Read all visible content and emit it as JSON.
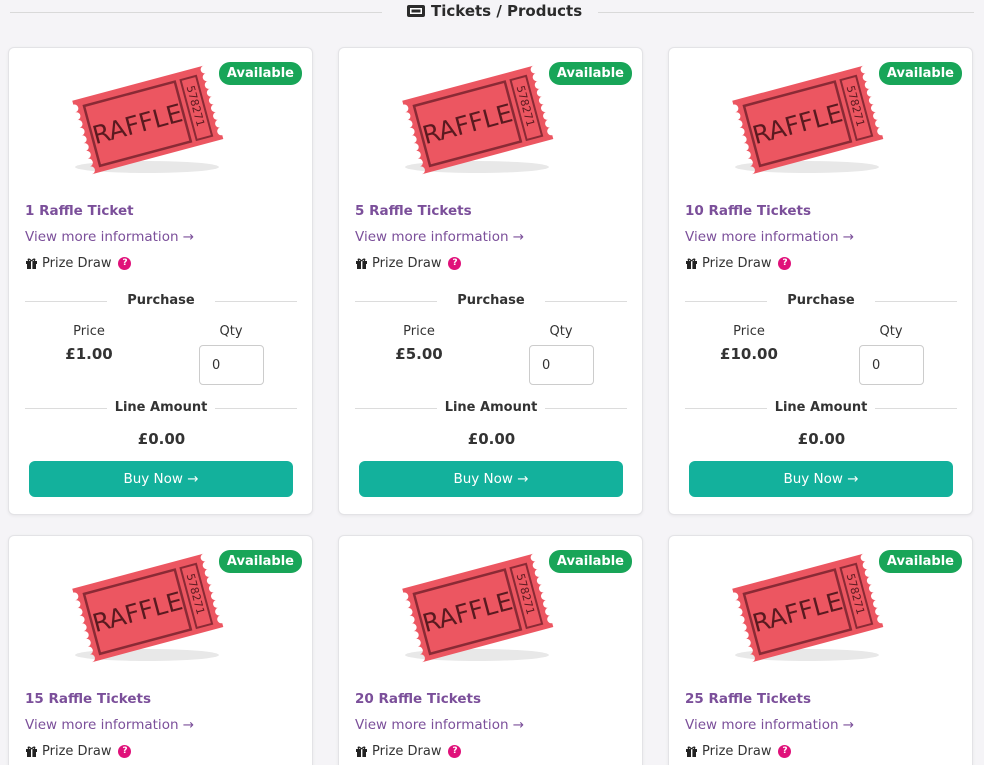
{
  "header": {
    "title": "Tickets / Products",
    "icon": "ticket-icon"
  },
  "labels": {
    "badge": "Available",
    "ticket_image_text": "RAFFLE",
    "ticket_serial": "578271",
    "more_info": "View more information →",
    "prize": "Prize Draw",
    "help": "?",
    "purchase": "Purchase",
    "price": "Price",
    "qty": "Qty",
    "line_amount": "Line Amount",
    "buy_now": "Buy Now →"
  },
  "colors": {
    "badge": "#18a558",
    "title": "#7b4f9a",
    "button": "#13b19c",
    "ticket": "#ec5661",
    "help": "#e0117a"
  },
  "products": [
    {
      "name": "1 Raffle Ticket",
      "price": "£1.00",
      "qty": "0",
      "amount": "£0.00"
    },
    {
      "name": "5 Raffle Tickets",
      "price": "£5.00",
      "qty": "0",
      "amount": "£0.00"
    },
    {
      "name": "10 Raffle Tickets",
      "price": "£10.00",
      "qty": "0",
      "amount": "£0.00"
    },
    {
      "name": "15 Raffle Tickets"
    },
    {
      "name": "20 Raffle Tickets"
    },
    {
      "name": "25 Raffle Tickets"
    }
  ]
}
